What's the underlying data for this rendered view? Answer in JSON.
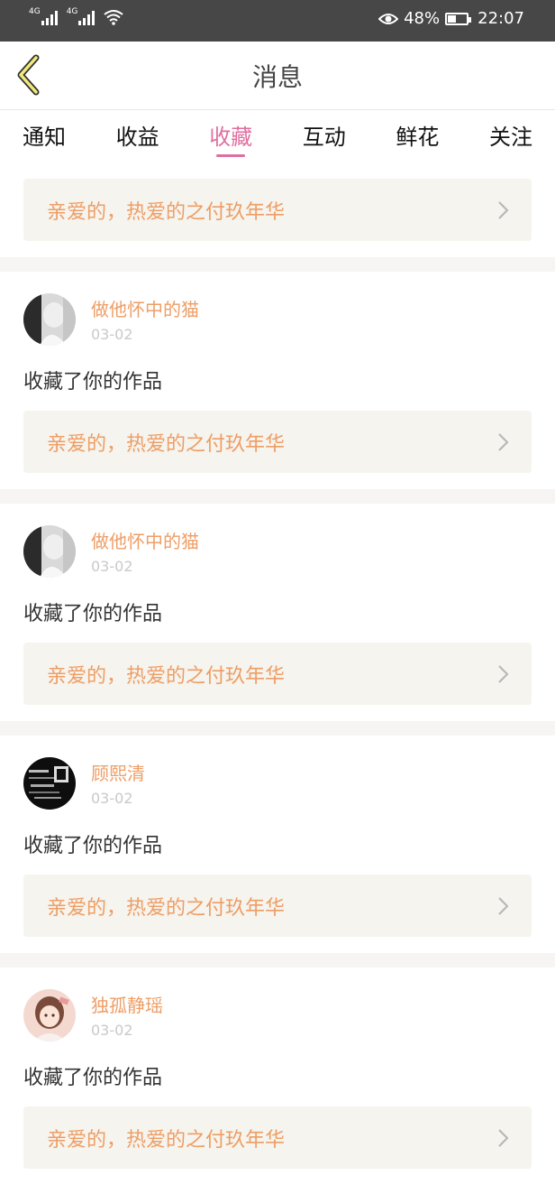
{
  "status_bar": {
    "signal1": "4G",
    "signal2": "4G",
    "battery": "48%",
    "time": "22:07"
  },
  "nav": {
    "title": "消息"
  },
  "tabs": [
    {
      "label": "通知"
    },
    {
      "label": "收益"
    },
    {
      "label": "收藏",
      "active": true
    },
    {
      "label": "互动"
    },
    {
      "label": "鲜花"
    },
    {
      "label": "关注"
    }
  ],
  "first_card": {
    "title": "亲爱的，热爱的之付玖年华"
  },
  "items": [
    {
      "user": "做他怀中的猫",
      "date": "03-02",
      "action": "收藏了你的作品",
      "work": "亲爱的，热爱的之付玖年华",
      "avatar": "avatar-1"
    },
    {
      "user": "做他怀中的猫",
      "date": "03-02",
      "action": "收藏了你的作品",
      "work": "亲爱的，热爱的之付玖年华",
      "avatar": "avatar-2"
    },
    {
      "user": "顾熙清",
      "date": "03-02",
      "action": "收藏了你的作品",
      "work": "亲爱的，热爱的之付玖年华",
      "avatar": "avatar-3"
    },
    {
      "user": "独孤静瑶",
      "date": "03-02",
      "action": "收藏了你的作品",
      "work": "亲爱的，热爱的之付玖年华",
      "avatar": "avatar-4"
    }
  ],
  "colors": {
    "accent_tab": "#e06fa0",
    "username": "#ee9e66",
    "card_bg": "#f5f4ee",
    "status_bar": "#474747"
  },
  "icons": {
    "back": "chevron-left-icon",
    "card": "chevron-right-icon",
    "eye": "eye-icon",
    "wifi": "wifi-icon",
    "battery": "battery-icon",
    "battery_level": 0.48
  }
}
